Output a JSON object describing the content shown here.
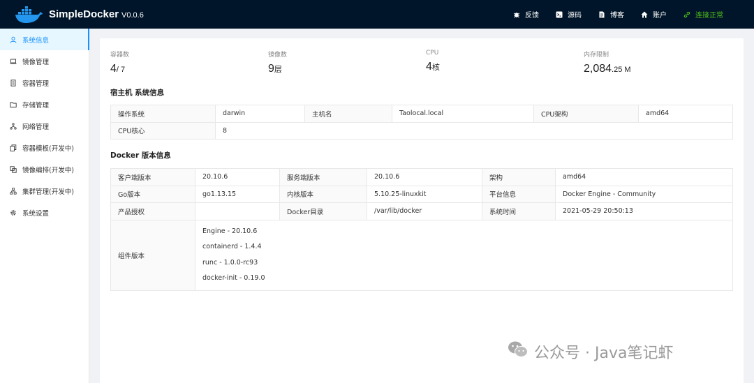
{
  "header": {
    "brand": "SimpleDocker",
    "version": "V0.0.6",
    "nav": [
      {
        "icon": "bug-icon",
        "label": "反馈"
      },
      {
        "icon": "code-icon",
        "label": "源码"
      },
      {
        "icon": "file-icon",
        "label": "博客"
      },
      {
        "icon": "home-icon",
        "label": "账户"
      },
      {
        "icon": "link-icon",
        "label": "连接正常"
      }
    ],
    "status_color": "#52c41a"
  },
  "sidebar": {
    "items": [
      {
        "icon": "user-icon",
        "label": "系统信息"
      },
      {
        "icon": "laptop-icon",
        "label": "镜像管理"
      },
      {
        "icon": "container-icon",
        "label": "容器管理"
      },
      {
        "icon": "folder-icon",
        "label": "存储管理"
      },
      {
        "icon": "network-icon",
        "label": "网络管理"
      },
      {
        "icon": "copy-icon",
        "label": "容器模板(开发中)"
      },
      {
        "icon": "block-icon",
        "label": "镜像编排(开发中)"
      },
      {
        "icon": "cluster-icon",
        "label": "集群管理(开发中)"
      },
      {
        "icon": "gear-icon",
        "label": "系统设置"
      }
    ],
    "active_color": "#1890ff"
  },
  "stats": [
    {
      "label": "容器数",
      "value": "4",
      "suffix": "/ 7"
    },
    {
      "label": "镜像数",
      "value": "9",
      "suffix": "层"
    },
    {
      "label": "CPU",
      "value": "4",
      "suffix": "核"
    },
    {
      "label": "内存限制",
      "value": "2,084",
      "suffix": ".25 M"
    }
  ],
  "host": {
    "title": "宿主机 系统信息",
    "os_label": "操作系统",
    "os": "darwin",
    "hostname_label": "主机名",
    "hostname": "Taolocal.local",
    "arch_label": "CPU架构",
    "arch": "amd64",
    "cores_label": "CPU核心",
    "cores": "8"
  },
  "docker": {
    "title": "Docker 版本信息",
    "client_label": "客户端版本",
    "client": "20.10.6",
    "server_label": "服务端版本",
    "server": "20.10.6",
    "arch_label": "架构",
    "arch": "amd64",
    "go_label": "Go版本",
    "go": "go1.13.15",
    "kernel_label": "内核版本",
    "kernel": "5.10.25-linuxkit",
    "platform_label": "平台信息",
    "platform": "Docker Engine - Community",
    "license_label": "产品授权",
    "license": "",
    "dir_label": "Docker目录",
    "dir": "/var/lib/docker",
    "time_label": "系统时间",
    "time": "2021-05-29 20:50:13",
    "components_label": "组件版本",
    "components": [
      "Engine - 20.10.6",
      "containerd - 1.4.4",
      "runc - 1.0.0-rc93",
      "docker-init - 0.19.0"
    ]
  },
  "watermark": "公众号 · Java笔记虾"
}
